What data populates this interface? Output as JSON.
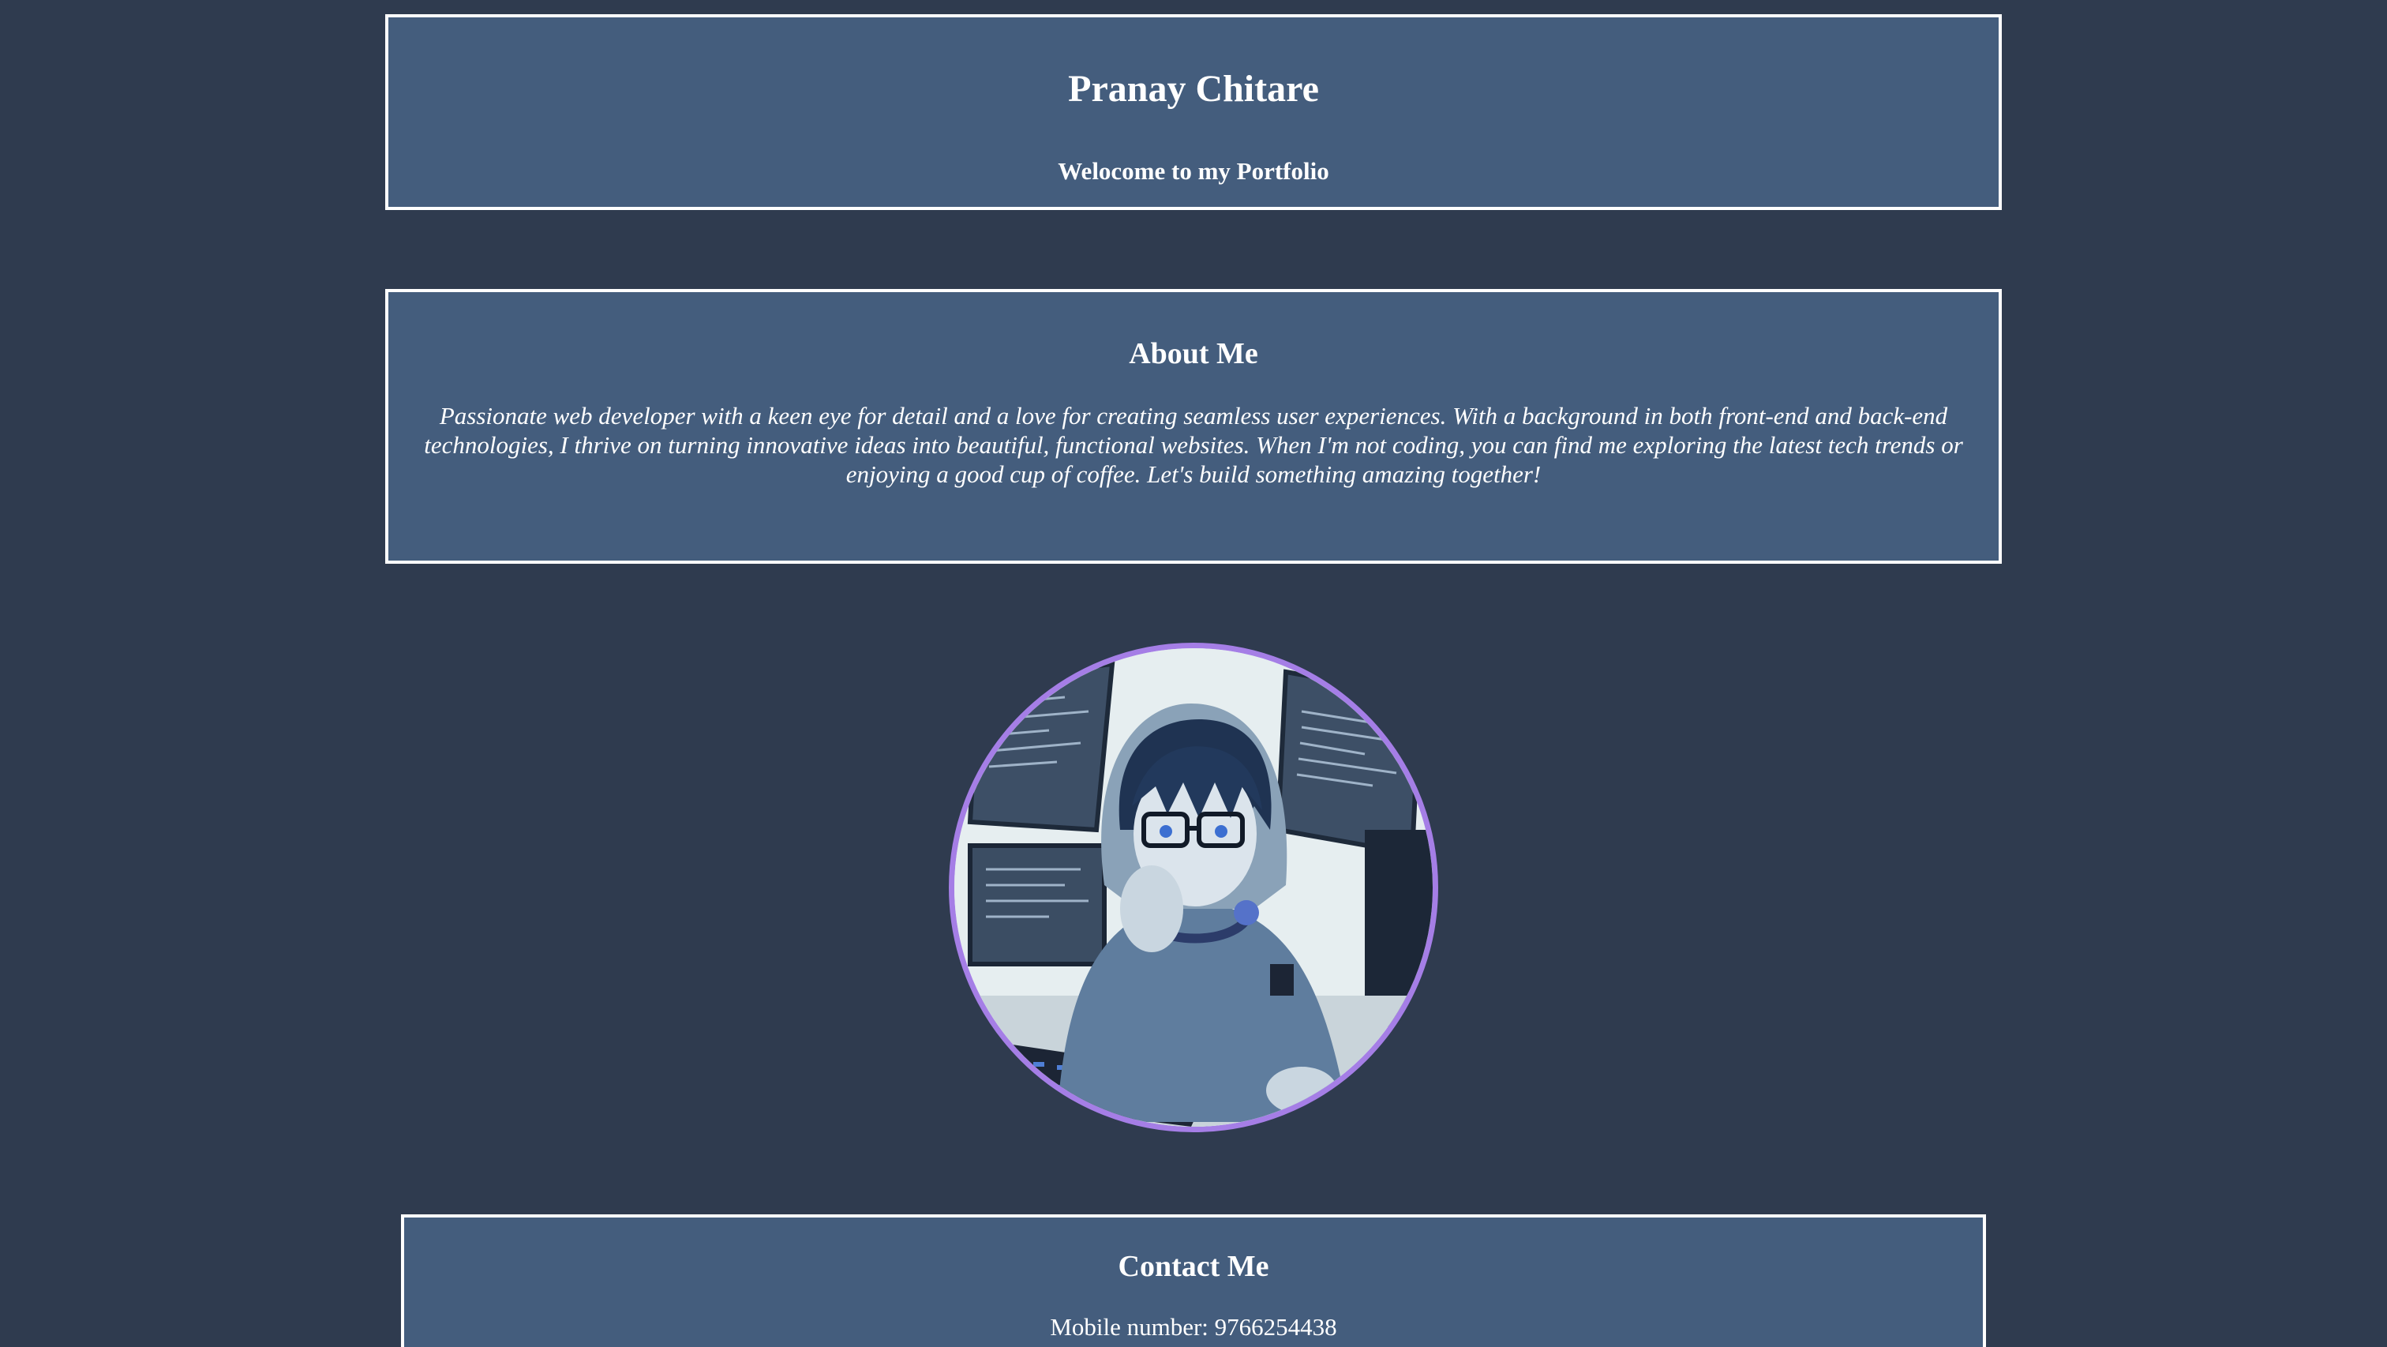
{
  "header": {
    "name": "Pranay Chitare",
    "tagline": "Welocome to my Portfolio"
  },
  "about": {
    "heading": "About Me",
    "text": "Passionate web developer with a keen eye for detail and a love for creating seamless user experiences. With a background in both front-end and back-end technologies, I thrive on turning innovative ideas into beautiful, functional websites. When I'm not coding, you can find me exploring the latest tech trends or enjoying a good cup of coffee. Let's build something amazing together!"
  },
  "avatar": {
    "border_color": "#a57ee6"
  },
  "contact": {
    "heading": "Contact Me",
    "mobile": "Mobile number: 9766254438"
  },
  "colors": {
    "page_background": "#2f3b4f",
    "card_background": "#445d7d",
    "card_border": "#ffffff",
    "text": "#ffffff"
  }
}
